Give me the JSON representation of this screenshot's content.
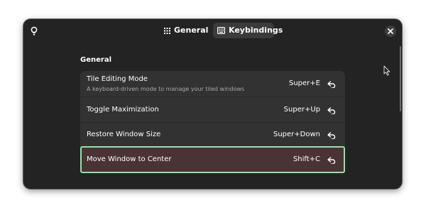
{
  "header": {
    "tabs": [
      {
        "label": "General",
        "icon": "grid-icon",
        "selected": false
      },
      {
        "label": "Keybindings",
        "icon": "keyboard-icon",
        "selected": true
      }
    ],
    "left_icon": "lightbulb-icon",
    "close_icon": "close-icon"
  },
  "section": {
    "title": "General"
  },
  "rows": [
    {
      "title": "Tile Editing Mode",
      "subtitle": "A keyboard-driven mode to manage your tiled windows",
      "accel": "Super+E"
    },
    {
      "title": "Toggle Maximization",
      "subtitle": "",
      "accel": "Super+Up"
    },
    {
      "title": "Restore Window Size",
      "subtitle": "",
      "accel": "Super+Down"
    },
    {
      "title": "Move Window to Center",
      "subtitle": "",
      "accel": "Shift+C",
      "highlighted": true
    }
  ],
  "colors": {
    "window_bg": "#232323",
    "list_bg": "#323232",
    "highlight_bg": "#4a3334",
    "highlight_border": "#8fe5a0",
    "tab_selected_bg": "#3b3b3b"
  }
}
